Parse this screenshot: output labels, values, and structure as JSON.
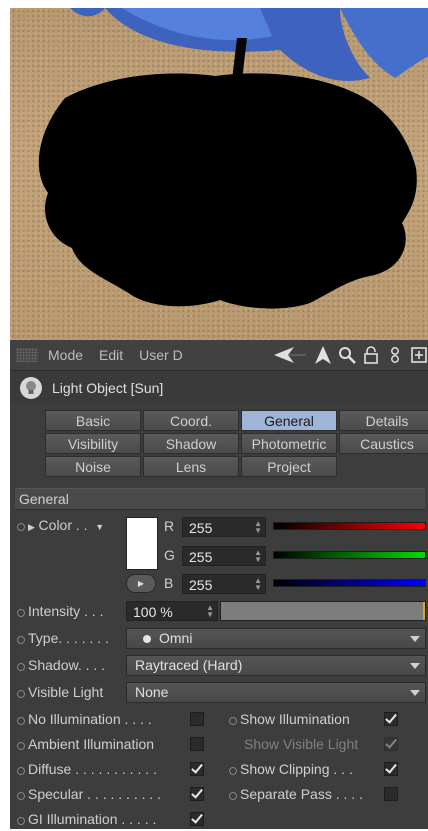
{
  "toolbar": {
    "menu": [
      "Mode",
      "Edit",
      "User D"
    ]
  },
  "object": {
    "title": "Light Object [Sun]"
  },
  "tabs": [
    {
      "label": "Basic"
    },
    {
      "label": "Coord."
    },
    {
      "label": "General"
    },
    {
      "label": "Details"
    },
    {
      "label": "Visibility"
    },
    {
      "label": "Shadow"
    },
    {
      "label": "Photometric"
    },
    {
      "label": "Caustics"
    },
    {
      "label": "Noise"
    },
    {
      "label": "Lens"
    },
    {
      "label": "Project"
    }
  ],
  "active_tab": "General",
  "section": {
    "title": "General"
  },
  "color": {
    "label": "Color . .",
    "swatch": "#ffffff",
    "r_label": "R",
    "r": "255",
    "g_label": "G",
    "g": "255",
    "b_label": "B",
    "b": "255"
  },
  "intensity": {
    "label": "Intensity . . .",
    "value": "100 %",
    "fraction": 1.0
  },
  "type": {
    "label": "Type. . . . . . .",
    "value": "Omni"
  },
  "shadow": {
    "label": "Shadow. . . .",
    "value": "Raytraced (Hard)"
  },
  "visible_light": {
    "label": "Visible Light",
    "value": "None"
  },
  "checks": {
    "no_illumination": {
      "label": "No Illumination . . . .",
      "checked": false
    },
    "show_illumination": {
      "label": "Show Illumination",
      "checked": true
    },
    "ambient_illumination": {
      "label": "Ambient Illumination",
      "checked": false
    },
    "show_visible_light": {
      "label": "Show Visible Light",
      "checked": true
    },
    "diffuse": {
      "label": "Diffuse . . . . . . . . . . .",
      "checked": true
    },
    "show_clipping": {
      "label": "Show Clipping . . .",
      "checked": true
    },
    "specular": {
      "label": "Specular . . . . . . . . . .",
      "checked": true
    },
    "separate_pass": {
      "label": "Separate Pass . . . .",
      "checked": false
    },
    "gi_illumination": {
      "label": "GI Illumination . . . . .",
      "checked": true
    }
  },
  "colors": {
    "accent_tab": "#9fb5d8",
    "panel_bg": "#3d3d3d",
    "umbrella_blue": "#4a70d0",
    "sand": "#c0a278"
  }
}
